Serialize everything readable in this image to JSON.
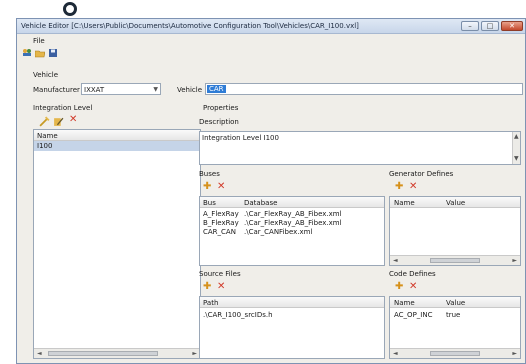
{
  "window": {
    "title": "Vehicle Editor [C:\\Users\\Public\\Documents\\Automotive Configuration Tool\\Vehicles\\CAR_I100.vxl]",
    "minimize_glyph": "–",
    "maximize_glyph": "□",
    "close_glyph": "✕"
  },
  "menu": {
    "file": "File"
  },
  "vehicle": {
    "section_label": "Vehicle",
    "manufacturer_label": "Manufacturer",
    "manufacturer_value": "IXXAT",
    "vehicle_label": "Vehicle",
    "vehicle_value": "CAR"
  },
  "integration": {
    "section_label": "Integration Level",
    "column_header": "Name",
    "rows": [
      "I100"
    ]
  },
  "properties": {
    "section_label": "Properties",
    "description_label": "Description",
    "description_value": "Integration Level I100"
  },
  "buses": {
    "label": "Buses",
    "columns": [
      "Bus",
      "Database"
    ],
    "rows": [
      [
        "A_FlexRay",
        ".\\Car_FlexRay_AB_Fibex.xml"
      ],
      [
        "B_FlexRay",
        ".\\Car_FlexRay_AB_Fibex.xml"
      ],
      [
        "CAR_CAN",
        ".\\Car_CANFibex.xml"
      ]
    ]
  },
  "generator_defines": {
    "label": "Generator Defines",
    "columns": [
      "Name",
      "Value"
    ]
  },
  "source_files": {
    "label": "Source Files",
    "column": "Path",
    "rows": [
      ".\\CAR_I100_srcIDs.h"
    ]
  },
  "code_defines": {
    "label": "Code Defines",
    "columns": [
      "Name",
      "Value"
    ],
    "rows": [
      [
        "AC_OP_INC",
        "true"
      ]
    ]
  },
  "colors": {
    "selection": "#2f7cd6",
    "title_bar": "#c8d6ea",
    "add_icon": "#d6911b",
    "delete_icon": "#d13a2a"
  }
}
